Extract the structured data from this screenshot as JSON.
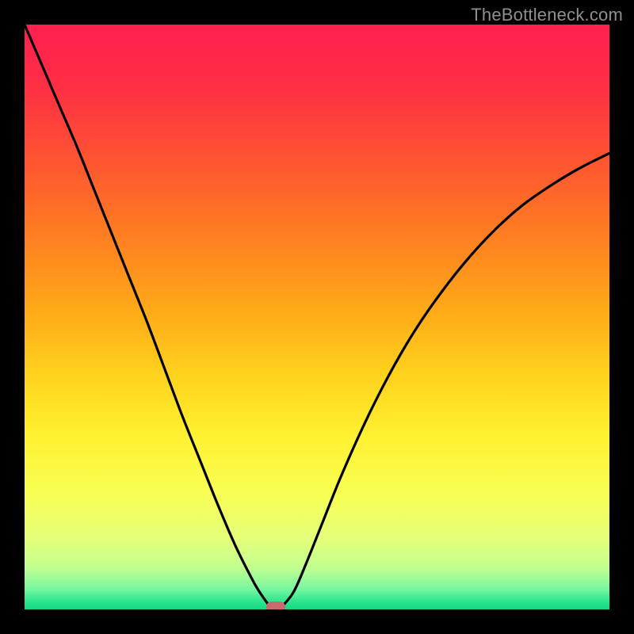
{
  "watermark": "TheBottleneck.com",
  "colors": {
    "frame": "#000000",
    "watermark": "#8f8f8f",
    "curve": "#000000",
    "marker": "#c76b6b"
  },
  "layout": {
    "image_size": 800,
    "inner_offset": 31,
    "inner_size": 738
  },
  "gradient_stops": [
    {
      "offset": 0.0,
      "color": "#ff1f4f"
    },
    {
      "offset": 0.1,
      "color": "#ff2d45"
    },
    {
      "offset": 0.2,
      "color": "#ff4a36"
    },
    {
      "offset": 0.3,
      "color": "#ff6a28"
    },
    {
      "offset": 0.4,
      "color": "#ff8b1e"
    },
    {
      "offset": 0.5,
      "color": "#ffae18"
    },
    {
      "offset": 0.6,
      "color": "#ffd21d"
    },
    {
      "offset": 0.7,
      "color": "#fff02f"
    },
    {
      "offset": 0.8,
      "color": "#f8ff52"
    },
    {
      "offset": 0.88,
      "color": "#e4ff7a"
    },
    {
      "offset": 0.93,
      "color": "#c0ff90"
    },
    {
      "offset": 0.965,
      "color": "#78f7a0"
    },
    {
      "offset": 0.985,
      "color": "#2fe890"
    },
    {
      "offset": 1.0,
      "color": "#15d87e"
    }
  ],
  "chart_data": {
    "type": "line",
    "title": "",
    "xlabel": "",
    "ylabel": "",
    "xlim": [
      0,
      100
    ],
    "ylim": [
      0,
      100
    ],
    "x": [
      0,
      3,
      6,
      9,
      12,
      15,
      18,
      21,
      24,
      27,
      30,
      33,
      36,
      39,
      40.5,
      42,
      43,
      44,
      46,
      48,
      51,
      54,
      58,
      62,
      66,
      70,
      75,
      80,
      85,
      90,
      95,
      100
    ],
    "values": [
      100,
      93,
      86,
      79,
      71.5,
      64,
      56.5,
      49,
      41,
      33,
      25.5,
      18,
      11,
      5,
      2.5,
      0.5,
      0,
      0.5,
      3,
      7.5,
      15,
      22.5,
      31.5,
      39.5,
      46.5,
      52.5,
      59,
      64.5,
      69,
      72.5,
      75.5,
      78
    ],
    "minimum": {
      "x": 43,
      "y": 0
    },
    "annotations": [],
    "legend": []
  }
}
